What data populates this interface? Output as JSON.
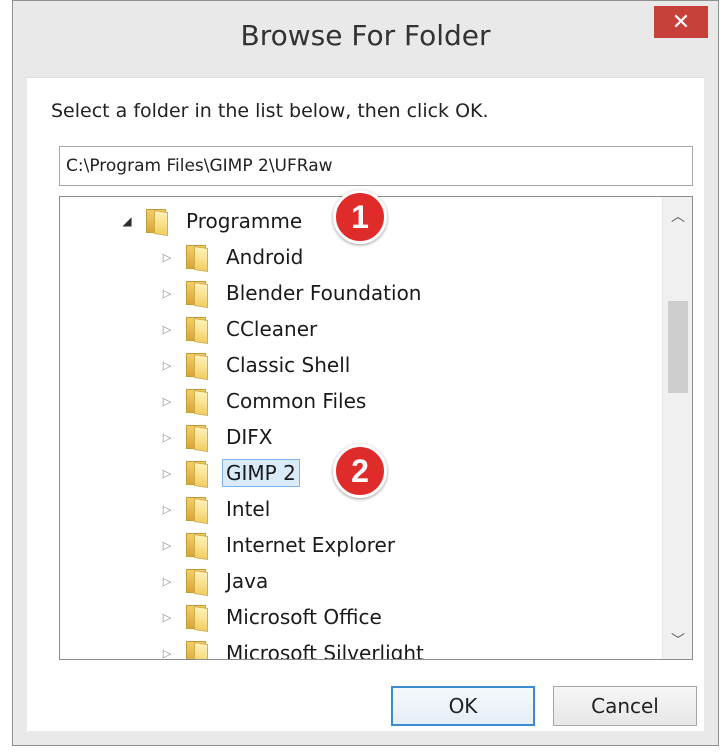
{
  "window": {
    "title": "Browse For Folder",
    "close_label": "✕"
  },
  "instruction": "Select a folder in the list below, then click OK.",
  "path_value": "C:\\Program Files\\GIMP 2\\UFRaw",
  "tree": {
    "root": {
      "label": "Programme",
      "expanded": true
    },
    "items": [
      {
        "label": "Android",
        "selected": false
      },
      {
        "label": "Blender Foundation",
        "selected": false
      },
      {
        "label": "CCleaner",
        "selected": false
      },
      {
        "label": "Classic Shell",
        "selected": false
      },
      {
        "label": "Common Files",
        "selected": false
      },
      {
        "label": "DIFX",
        "selected": false
      },
      {
        "label": "GIMP 2",
        "selected": true
      },
      {
        "label": "Intel",
        "selected": false
      },
      {
        "label": "Internet Explorer",
        "selected": false
      },
      {
        "label": "Java",
        "selected": false
      },
      {
        "label": "Microsoft Office",
        "selected": false
      },
      {
        "label": "Microsoft Silverlight",
        "selected": false
      }
    ]
  },
  "markers": [
    "1",
    "2"
  ],
  "buttons": {
    "ok": "OK",
    "cancel": "Cancel"
  },
  "icons": {
    "folder": "folder-icon",
    "expand": "triangle-right-icon",
    "collapse": "triangle-down-icon",
    "scroll_up": "chevron-up-icon",
    "scroll_down": "chevron-down-icon",
    "close": "close-icon"
  },
  "colors": {
    "close_button": "#c7403a",
    "marker": "#e02b2b",
    "selection": "#d9ebf9",
    "default_button_border": "#3b8bd1"
  }
}
